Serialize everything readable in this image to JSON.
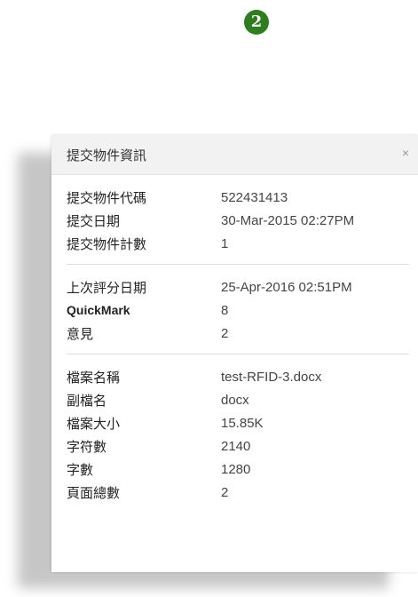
{
  "step_badge": "2",
  "panel": {
    "title": "提交物件資訊",
    "close_label": "×"
  },
  "sections": [
    {
      "rows": [
        {
          "label": "提交物件代碼",
          "value": "522431413"
        },
        {
          "label": "提交日期",
          "value": "30-Mar-2015 02:27PM"
        },
        {
          "label": "提交物件計數",
          "value": "1"
        }
      ]
    },
    {
      "rows": [
        {
          "label": "上次評分日期",
          "value": "25-Apr-2016 02:51PM"
        },
        {
          "label": "QuickMark",
          "value": "8"
        },
        {
          "label": "意見",
          "value": "2"
        }
      ]
    },
    {
      "rows": [
        {
          "label": "檔案名稱",
          "value": "test-RFID-3.docx"
        },
        {
          "label": "副檔名",
          "value": "docx"
        },
        {
          "label": "檔案大小",
          "value": "15.85K"
        },
        {
          "label": "字符數",
          "value": "2140"
        },
        {
          "label": "字數",
          "value": "1280"
        },
        {
          "label": "頁面總數",
          "value": "2"
        }
      ]
    }
  ],
  "colors": {
    "badge": "#2e7d1e",
    "header_bg": "#f2f2f2"
  }
}
